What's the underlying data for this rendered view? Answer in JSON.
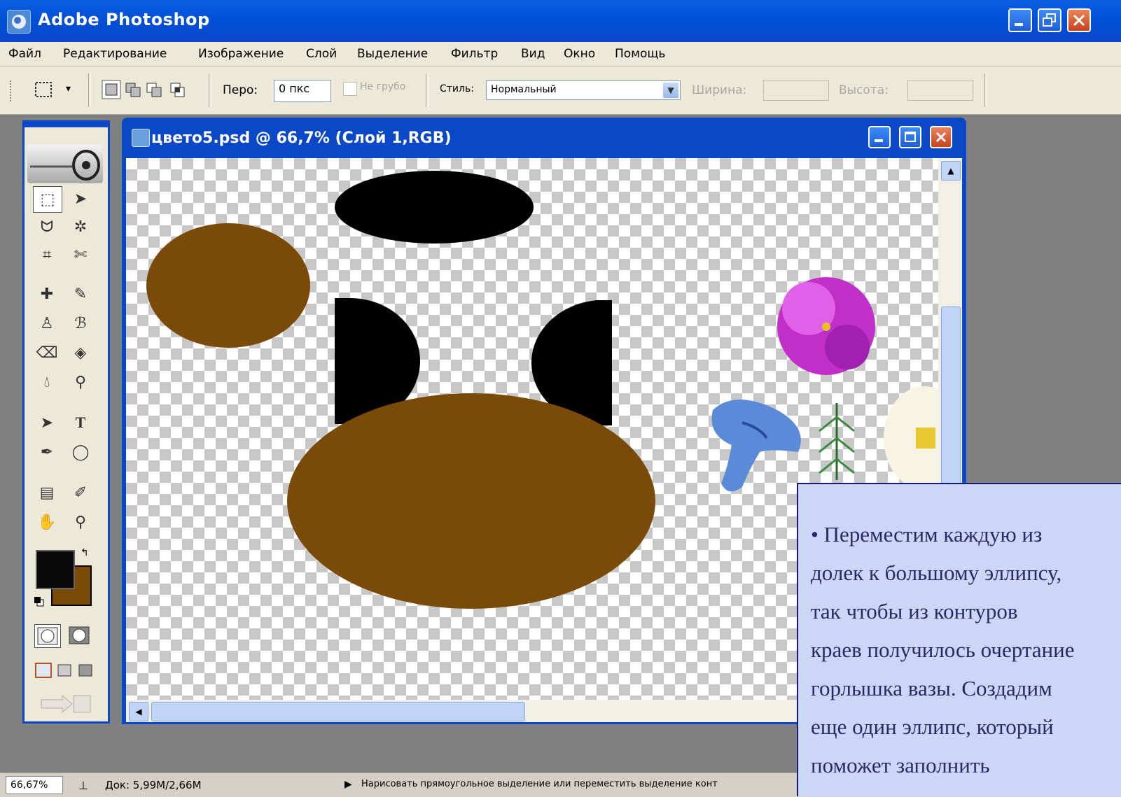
{
  "app": {
    "title": "Adobe Photoshop"
  },
  "menu": [
    "Файл",
    "Редактирование",
    "Изображение",
    "Слой",
    "Выделение",
    "Фильтр",
    "Вид",
    "Окно",
    "Помощь"
  ],
  "options": {
    "feather_label": "Перо:",
    "feather_value": "0 пкс",
    "antialias_label": "Не грубо",
    "style_label": "Стиль:",
    "style_value": "Нормальный",
    "width_label": "Ширина:",
    "height_label": "Высота:"
  },
  "document": {
    "title": "цвето5.psd @ 66,7% (Слой 1,RGB)"
  },
  "status": {
    "zoom": "66,67%",
    "doc_info": "Док: 5,99M/2,66M",
    "hint": "Нарисовать прямоугольное выделение или переместить выделение конт"
  },
  "callout": {
    "text": "•   Переместим каждую из\nдолек к большому эллипсу,\nтак чтобы из контуров\nкраев получилось очертание\nгорлышка вазы. Создадим\nеще один эллипс, который\nпоможет заполнить"
  },
  "colors": {
    "foreground": "#0a0a0a",
    "background": "#7a4a08",
    "brown_shape": "#7a4a08",
    "black_shape": "#000000"
  }
}
